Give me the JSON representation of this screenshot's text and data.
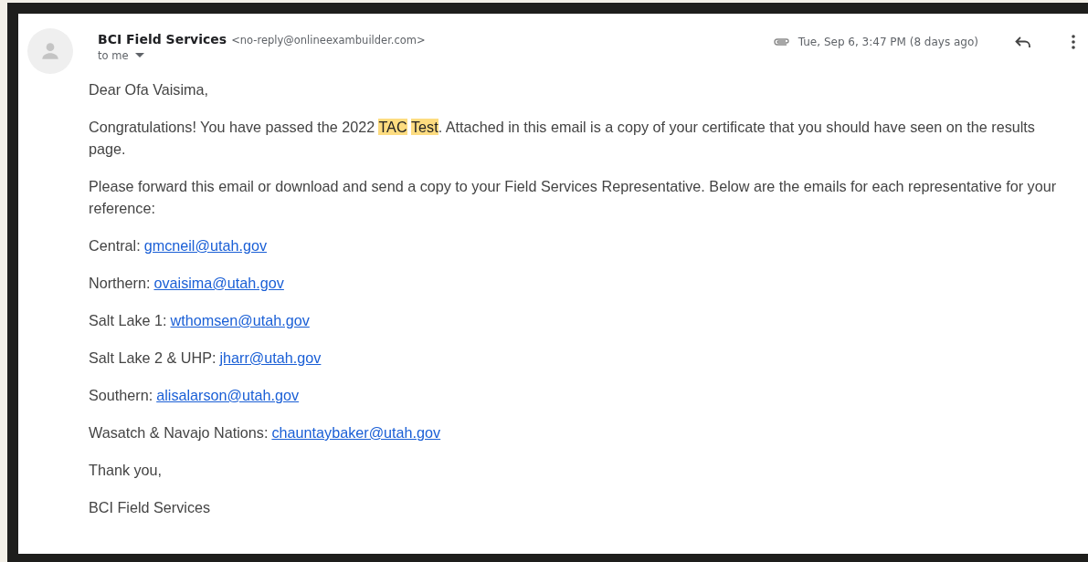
{
  "message": {
    "sender_name": "BCI Field Services",
    "sender_email": "<no-reply@onlineexambuilder.com>",
    "recipient": "to me",
    "date": "Tue, Sep 6, 3:47 PM (8 days ago)",
    "has_attachment": true
  },
  "body": [
    {
      "kind": "text",
      "text": "Dear Ofa Vaisima,"
    },
    {
      "kind": "segments",
      "segments": [
        {
          "text": "Congratulations! You have passed the 2022 ",
          "highlighted": false
        },
        {
          "text": "TAC",
          "highlighted": true
        },
        {
          "text": "Test",
          "highlighted": true,
          "space_before": true
        },
        {
          "text": ". Attached in this email is a copy of your certificate that you should have seen on the results page.",
          "highlighted": false
        }
      ]
    },
    {
      "kind": "text",
      "text": "Please forward this email or download and send a copy to your Field Services Representative. Below are the emails for each representative for your reference:"
    },
    {
      "kind": "contact",
      "label": "Central:",
      "email": "gmcneil@utah.gov"
    },
    {
      "kind": "contact",
      "label": "Northern:",
      "email": "ovaisima@utah.gov"
    },
    {
      "kind": "contact",
      "label": "Salt Lake 1:",
      "email": "wthomsen@utah.gov"
    },
    {
      "kind": "contact",
      "label": "Salt Lake 2 & UHP:",
      "email": "jharr@utah.gov"
    },
    {
      "kind": "contact",
      "label": "Southern:",
      "email": "alisalarson@utah.gov"
    },
    {
      "kind": "contact",
      "label": "Wasatch & Navajo Nations:",
      "email": "chauntaybaker@utah.gov"
    },
    {
      "kind": "text",
      "text": "Thank you,"
    },
    {
      "kind": "text",
      "text": "BCI Field Services"
    }
  ]
}
